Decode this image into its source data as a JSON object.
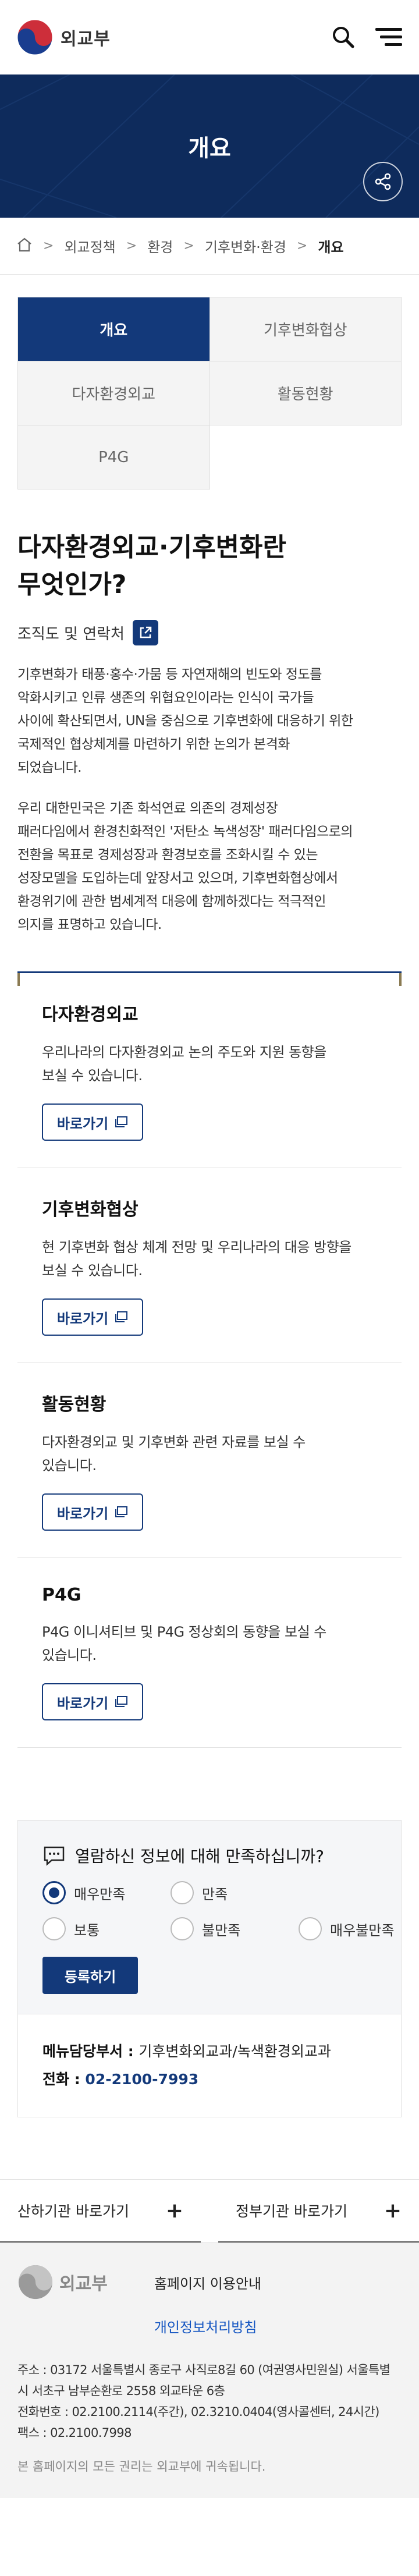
{
  "header": {
    "logo_text": "외교부",
    "search_icon": "search-icon",
    "menu_icon": "hamburger-menu-icon"
  },
  "banner": {
    "title": "개요",
    "share_icon": "share-icon"
  },
  "breadcrumb": {
    "home_icon": "home-icon",
    "items": [
      "외교정책",
      "환경",
      "기후변화·환경",
      "개요"
    ]
  },
  "tabs": [
    {
      "label": "개요",
      "active": true
    },
    {
      "label": "기후변화협상",
      "active": false
    },
    {
      "label": "다자환경외교",
      "active": false
    },
    {
      "label": "활동현황",
      "active": false
    },
    {
      "label": "P4G",
      "active": false
    }
  ],
  "intro": {
    "title_line1": "다자환경외교·기후변화란",
    "title_line2": "무엇인가?",
    "org_label": "조직도 및 연락처",
    "para1_lines": [
      "기후변화가 태풍·홍수·가뭄 등 자연재해의 빈도와 정도를",
      "악화시키고 인류 생존의 위협요인이라는 인식이 국가들",
      "사이에 확산되면서, UN을 중심으로 기후변화에 대응하기 위한",
      "국제적인 협상체계를 마련하기 위한 논의가 본격화",
      "되었습니다."
    ],
    "para2_lines": [
      "우리 대한민국은 기존 화석연료 의존의 경제성장",
      "패러다임에서 환경친화적인 '저탄소 녹색성장' 패러다임으로의",
      "전환을 목표로 경제성장과 환경보호를 조화시킬 수 있는",
      "성장모델을 도입하는데 앞장서고 있으며, 기후변화협상에서",
      "환경위기에 관한 범세계적 대응에 함께하겠다는 적극적인",
      "의지를 표명하고 있습니다."
    ]
  },
  "cards": [
    {
      "title": "다자환경외교",
      "desc_lines": [
        "우리나라의 다자환경외교 논의 주도와 지원 동향을",
        "보실 수 있습니다."
      ],
      "button": "바로가기"
    },
    {
      "title": "기후변화협상",
      "desc_lines": [
        "현 기후변화 협상 체계 전망 및 우리나라의 대응 방향을",
        "보실 수 있습니다."
      ],
      "button": "바로가기"
    },
    {
      "title": "활동현황",
      "desc_lines": [
        "다자환경외교 및 기후변화 관련 자료를 보실 수",
        "있습니다."
      ],
      "button": "바로가기"
    },
    {
      "title": "P4G",
      "desc_lines": [
        "P4G 이니셔티브 및 P4G 정상회의 동향을 보실 수",
        "있습니다."
      ],
      "button": "바로가기"
    }
  ],
  "survey": {
    "question": "열람하신 정보에 대해 만족하십니까?",
    "options": [
      "매우만족",
      "만족",
      "보통",
      "불만족",
      "매우불만족"
    ],
    "selected": "매우만족",
    "submit": "등록하기"
  },
  "dept": {
    "dept_label": "메뉴담당부서",
    "dept_value": "기후변화외교과/녹색환경외교과",
    "phone_label": "전화",
    "phone_value": "02-2100-7993"
  },
  "footer": {
    "related1": "산하기관 바로가기",
    "related2": "정부기관 바로가기",
    "logo_text": "외교부",
    "link1": "홈페이지 이용안내",
    "link2": "개인정보처리방침",
    "address_line1": "주소 : 03172 서울특별시 종로구 사직로8길 60 (여권영사민원실) 서울특별",
    "address_line2": "시 서초구 남부순환로 2558 외교타운 6층",
    "phone_line": "전화번호 : 02.2100.2114(주간), 02.3210.0404(영사콜센터, 24시간)",
    "fax_line": "팩스 : 02.2100.7998",
    "copyright": "본 홈페이지의 모든 권리는 외교부에 귀속됩니다."
  }
}
